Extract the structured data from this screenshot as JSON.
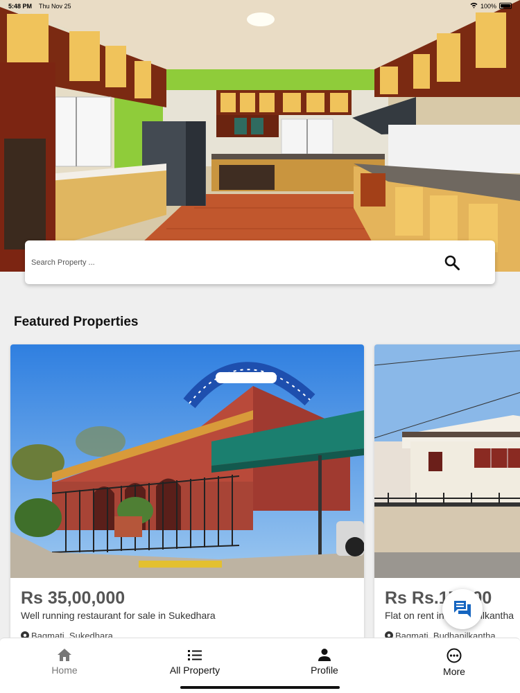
{
  "status_bar": {
    "time": "5:48 PM",
    "date": "Thu Nov 25",
    "battery": "100%"
  },
  "search": {
    "placeholder": "Search Property ..."
  },
  "featured": {
    "title": "Featured Properties",
    "cards": [
      {
        "price": "Rs 35,00,000",
        "description": "Well running restaurant for sale in Sukedhara",
        "location": "Bagmati, Sukedhara",
        "image_icon": "restaurant-building-image"
      },
      {
        "price": "Rs Rs.17,000",
        "description": "Flat on rent in Budhanilkantha",
        "location": "Bagmati, Budhanilkantha",
        "image_icon": "house-image"
      }
    ]
  },
  "bottom_nav": {
    "items": [
      {
        "label": "Home",
        "icon": "home-icon"
      },
      {
        "label": "All Property",
        "icon": "list-icon"
      },
      {
        "label": "Profile",
        "icon": "person-icon"
      },
      {
        "label": "More",
        "icon": "more-icon"
      }
    ]
  },
  "colors": {
    "accent": "#1565c0",
    "background": "#efefef",
    "price_text": "#555555"
  }
}
